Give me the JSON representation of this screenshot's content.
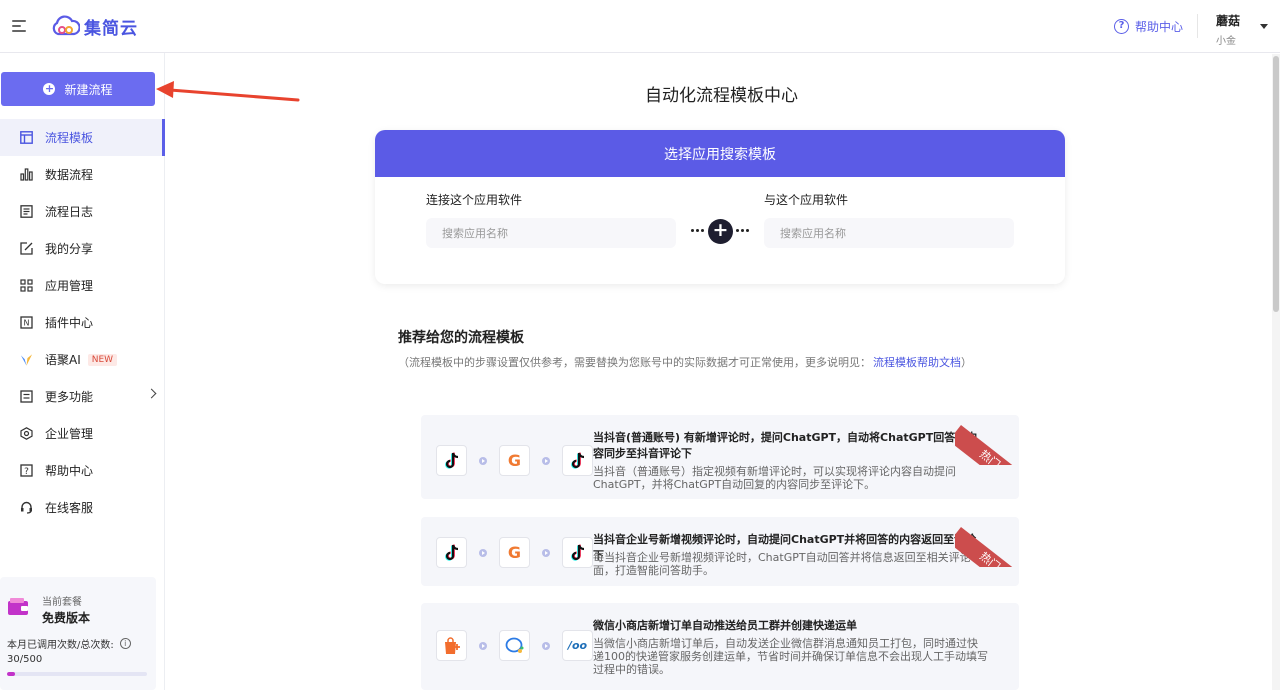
{
  "header": {
    "logo_text": "集简云",
    "help_label": "帮助中心",
    "user_name": "蘑菇",
    "user_sub": "小金"
  },
  "sidebar": {
    "new_flow_label": "新建流程",
    "items": [
      {
        "label": "流程模板",
        "icon": "template-icon",
        "active": true
      },
      {
        "label": "数据流程",
        "icon": "bar-chart-icon"
      },
      {
        "label": "流程日志",
        "icon": "log-icon"
      },
      {
        "label": "我的分享",
        "icon": "share-edit-icon"
      },
      {
        "label": "应用管理",
        "icon": "apps-grid-icon"
      },
      {
        "label": "插件中心",
        "icon": "plugin-icon"
      },
      {
        "label": "语聚AI",
        "icon": "ai-icon",
        "badge": "NEW"
      },
      {
        "label": "更多功能",
        "icon": "more-icon",
        "has_arrow": true
      },
      {
        "label": "企业管理",
        "icon": "enterprise-icon"
      },
      {
        "label": "帮助中心",
        "icon": "help-icon"
      },
      {
        "label": "在线客服",
        "icon": "headset-icon"
      }
    ],
    "plan": {
      "label": "当前套餐",
      "name": "免费版本",
      "usage_label": "本月已调用次数/总次数:",
      "usage_value": "30/500",
      "usage_fraction": 0.06
    }
  },
  "main": {
    "title": "自动化流程模板中心",
    "search_card": {
      "header": "选择应用搜索模板",
      "left_label": "连接这个应用软件",
      "right_label": "与这个应用软件",
      "left_placeholder": "搜索应用名称",
      "right_placeholder": "搜索应用名称"
    },
    "recommend": {
      "title": "推荐给您的流程模板",
      "note_prefix": "（流程模板中的步骤设置仅供参考，需要替换为您账号中的实际数据才可正常使用，更多说明见：",
      "note_link": "流程模板帮助文档",
      "note_suffix": "）"
    },
    "templates": [
      {
        "title": "当抖音(普通账号) 有新增评论时，提问ChatGPT，自动将ChatGPT回答的内容同步至抖音评论下",
        "desc": "当抖音（普通账号）指定视频有新增评论时，可以实现将评论内容自动提问ChatGPT，并将ChatGPT自动回复的内容同步至评论下。",
        "ribbon": "热门",
        "icons": [
          "tiktok-icon",
          "chatgpt-g-icon",
          "tiktok-icon"
        ]
      },
      {
        "title": "当抖音企业号新增视频评论时，自动提问ChatGPT并将回答的内容返回至评论下",
        "desc": "每当抖音企业号新增视频评论时，ChatGPT自动回答并将信息返回至相关评论下面，打造智能问答助手。",
        "ribbon": "热门",
        "icons": [
          "tiktok-icon",
          "chatgpt-g-icon",
          "tiktok-icon"
        ]
      },
      {
        "title": "微信小商店新增订单自动推送给员工群并创建快递运单",
        "desc": "当微信小商店新增订单后，自动发送企业微信群消息通知员工打包，同时通过快递100的快递管家服务创建运单，节省时间并确保订单信息不会出现人工手动填写过程中的错误。",
        "ribbon": "",
        "icons": [
          "wechat-shop-icon",
          "wecom-icon",
          "kuaidi100-icon"
        ]
      }
    ]
  },
  "colors": {
    "accent": "#5b5be6",
    "ribbon": "#cc4d4d"
  }
}
